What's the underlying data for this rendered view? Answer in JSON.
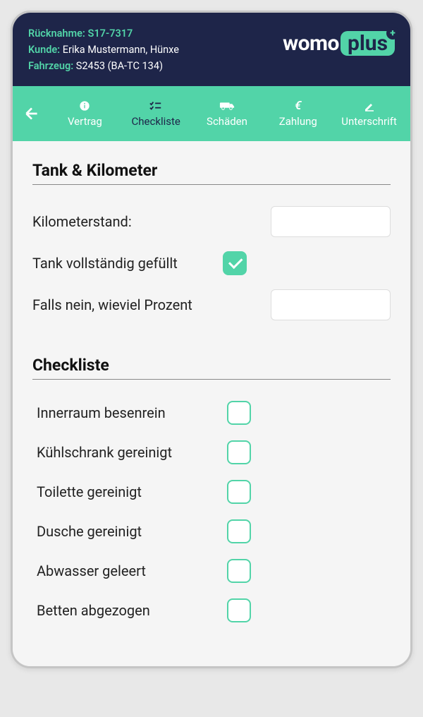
{
  "header": {
    "ruecknahme_label": "Rücknahme:",
    "ruecknahme_value": "S17-7317",
    "kunde_label": "Kunde:",
    "kunde_value": "Erika Mustermann, Hünxe",
    "fahrzeug_label": "Fahrzeug:",
    "fahrzeug_value": "S2453 (BA-TC 134)"
  },
  "logo": {
    "part1": "womo",
    "part2": "plus"
  },
  "tabs": {
    "items": [
      {
        "label": "Vertrag",
        "icon": "info"
      },
      {
        "label": "Checkliste",
        "icon": "checklist"
      },
      {
        "label": "Schäden",
        "icon": "van"
      },
      {
        "label": "Zahlung",
        "icon": "euro"
      },
      {
        "label": "Unterschrift",
        "icon": "sign"
      }
    ],
    "active_index": 1
  },
  "section1": {
    "title": "Tank & Kilometer",
    "km_label": "Kilometerstand:",
    "km_value": "",
    "tank_full_label": "Tank vollständig gefüllt",
    "tank_full_checked": true,
    "percent_label": "Falls nein, wieviel Prozent",
    "percent_value": ""
  },
  "section2": {
    "title": "Checkliste",
    "items": [
      {
        "label": "Innerraum besenrein",
        "checked": false
      },
      {
        "label": "Kühlschrank gereinigt",
        "checked": false
      },
      {
        "label": "Toilette gereinigt",
        "checked": false
      },
      {
        "label": "Dusche gereinigt",
        "checked": false
      },
      {
        "label": "Abwasser geleert",
        "checked": false
      },
      {
        "label": "Betten abgezogen",
        "checked": false
      }
    ]
  }
}
